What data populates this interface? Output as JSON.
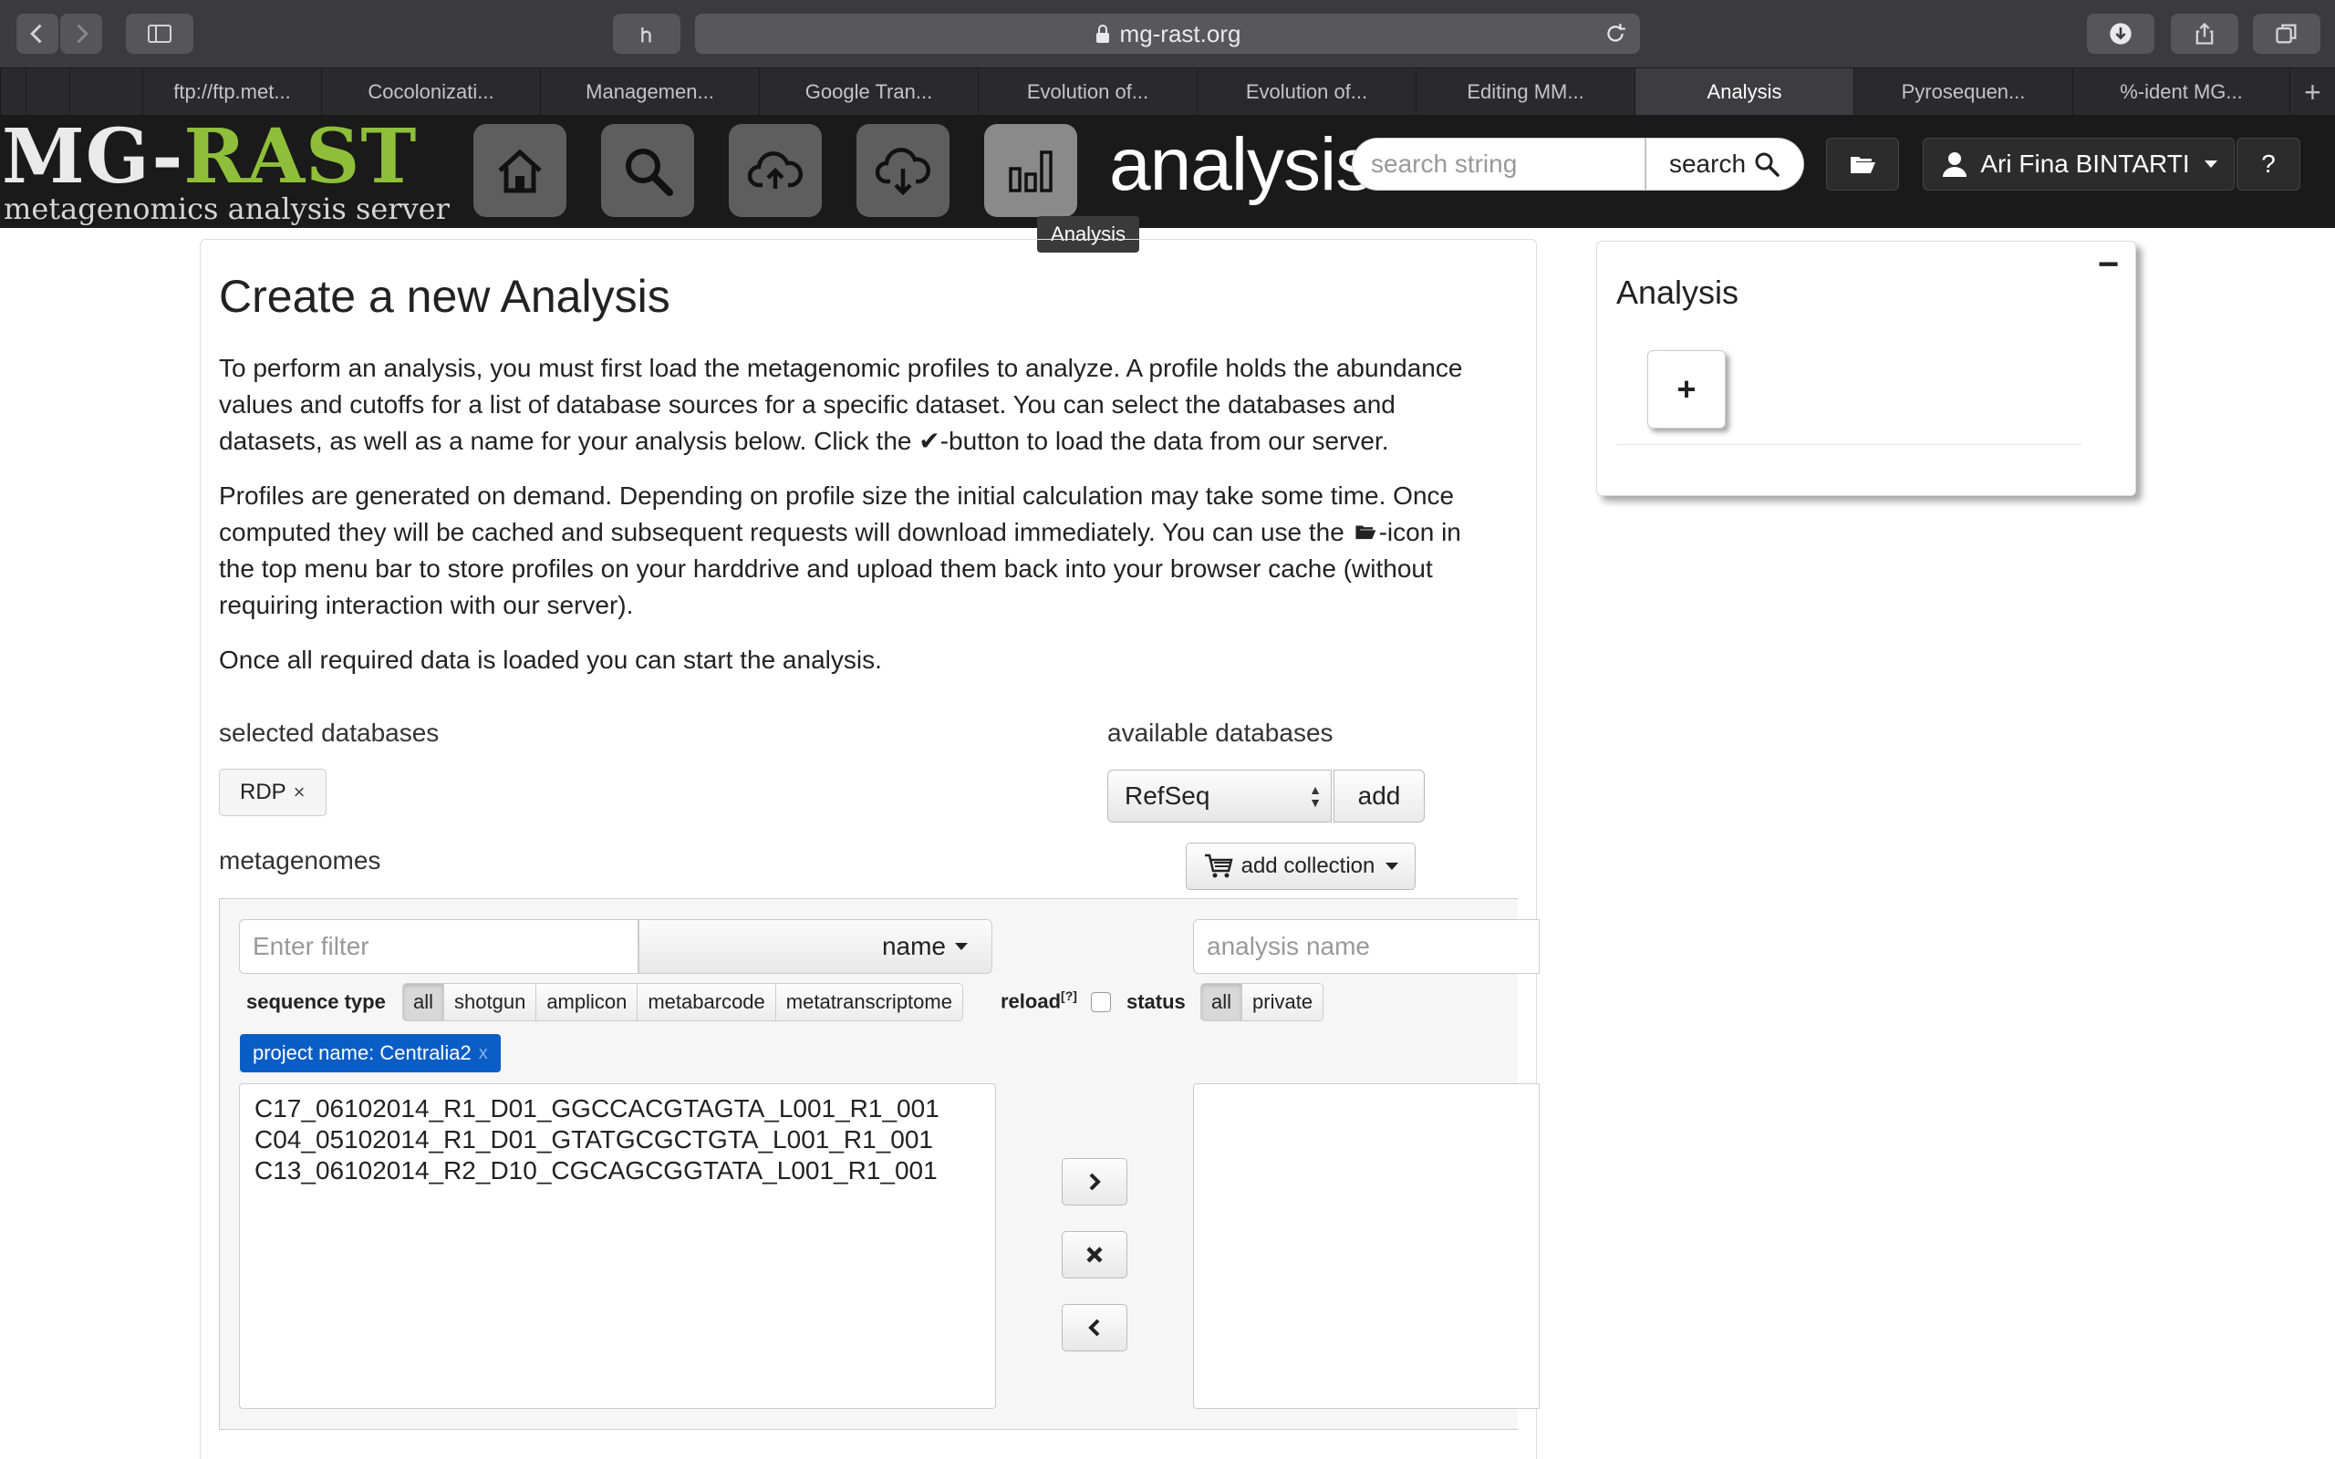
{
  "browser": {
    "url": "mg-rast.org",
    "tabs": [
      {
        "label": ""
      },
      {
        "label": ""
      },
      {
        "label": "ftp://ftp.met..."
      },
      {
        "label": "Cocolonizati..."
      },
      {
        "label": "Managemen..."
      },
      {
        "label": "Google Tran..."
      },
      {
        "label": "Evolution of..."
      },
      {
        "label": "Evolution of..."
      },
      {
        "label": "Editing MM..."
      },
      {
        "label": "Analysis"
      },
      {
        "label": "Pyrosequen..."
      },
      {
        "label": "%-ident MG..."
      }
    ],
    "active_tab_index": 9,
    "new_tab": "+"
  },
  "header": {
    "logo_top_mg": "MG-",
    "logo_top_rast": "RAST",
    "logo_sub": "metagenomics analysis server",
    "nav_icons": [
      "home-icon",
      "search-icon",
      "upload-icon",
      "download-icon",
      "analysis-icon"
    ],
    "tooltip": "Analysis",
    "section_title": "analysis",
    "search_placeholder": "search string",
    "search_button": "search",
    "user_name": "Ari Fina BINTARTI",
    "help": "?"
  },
  "main": {
    "title": "Create a new Analysis",
    "para1_a": "To perform an analysis, you must first load the metagenomic profiles to analyze. A profile holds the abundance values and cutoffs for a list of database sources for a specific dataset. You can select the databases and datasets, as well as a name for your analysis below. Click the ",
    "para1_b": "-button to load the data from our server.",
    "para2_a": "Profiles are generated on demand. Depending on profile size the initial calculation may take some time. Once computed they will be cached and subsequent requests will download immediately. You can use the ",
    "para2_b": "-icon in the top menu bar to store profiles on your harddrive and upload them back into your browser cache (without requiring interaction with our server).",
    "para3": "Once all required data is loaded you can start the analysis.",
    "selected_databases_label": "selected databases",
    "selected_tag": "RDP",
    "tag_remove": "×",
    "available_databases_label": "available databases",
    "database_select_value": "RefSeq",
    "add_button": "add",
    "metagenomes_label": "metagenomes",
    "add_collection_button": "add collection",
    "filter_placeholder": "Enter filter",
    "name_button": "name",
    "analysis_name_placeholder": "analysis name",
    "sequence_type_label": "sequence type",
    "sequence_types": [
      "all",
      "shotgun",
      "amplicon",
      "metabarcode",
      "metatranscriptome"
    ],
    "reload_label": "reload",
    "reload_help": "[?]",
    "status_label": "status",
    "status_options": [
      "all",
      "private"
    ],
    "filter_chip": "project name: Centralia2",
    "chip_remove": "x",
    "metagenome_list": [
      "C17_06102014_R1_D01_GGCCACGTAGTA_L001_R1_001",
      "C04_05102014_R1_D01_GTATGCGCTGTA_L001_R1_001",
      "C13_06102014_R2_D10_CGCAGCGGTATA_L001_R1_001"
    ]
  },
  "side_panel": {
    "title": "Analysis",
    "minimize": "−",
    "add": "+"
  }
}
